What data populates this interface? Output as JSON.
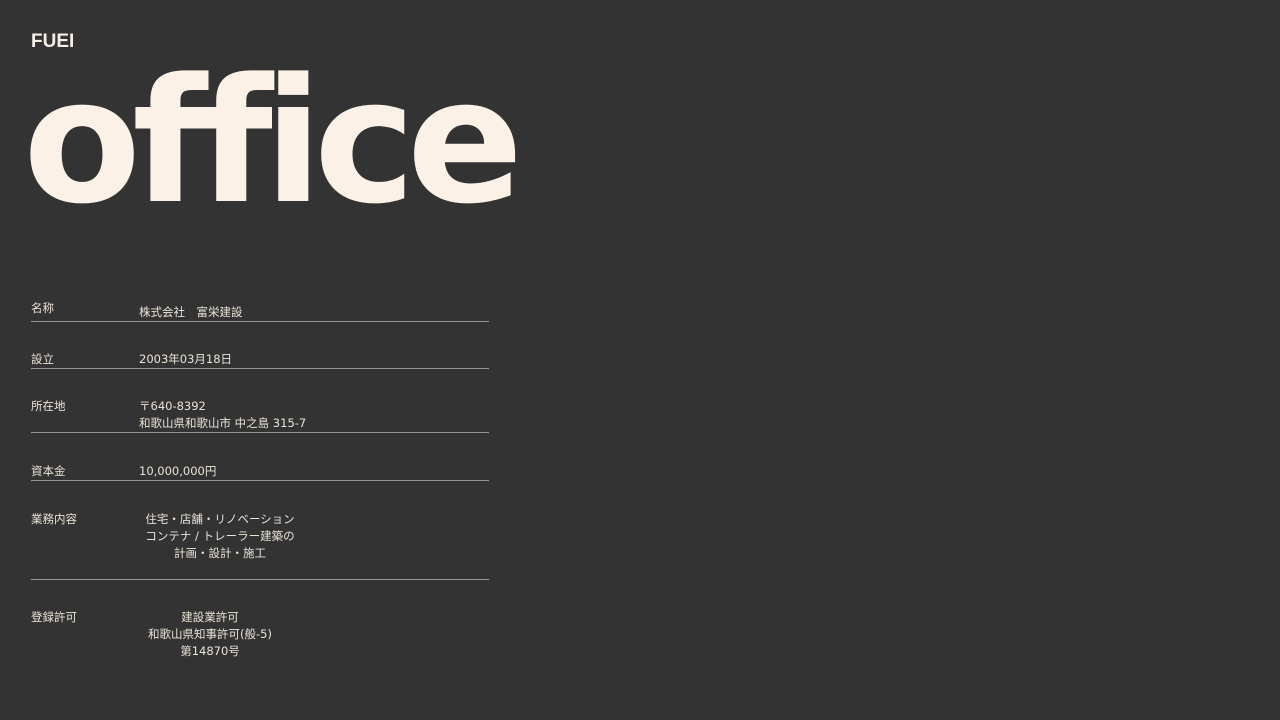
{
  "brand": {
    "logo": "FUEI"
  },
  "hero": {
    "title": "office"
  },
  "company_info": [
    {
      "label": "名称",
      "lines": [
        "株式会社　富栄建設"
      ]
    },
    {
      "label": "設立",
      "lines": [
        "2003年03月18日"
      ]
    },
    {
      "label": "所在地",
      "lines": [
        "〒640-8392",
        "和歌山県和歌山市 中之島 315-7"
      ]
    },
    {
      "label": "資本金",
      "lines": [
        "10,000,000円"
      ]
    },
    {
      "label": "業務内容",
      "lines": [
        "住宅・店舗・リノベーション",
        "コンテナ / トレーラー建築の",
        "計画・設計・施工"
      ]
    },
    {
      "label": "登録許可",
      "lines": [
        "建設業許可",
        "和歌山県知事許可(般-5)",
        "第14870号"
      ]
    }
  ]
}
